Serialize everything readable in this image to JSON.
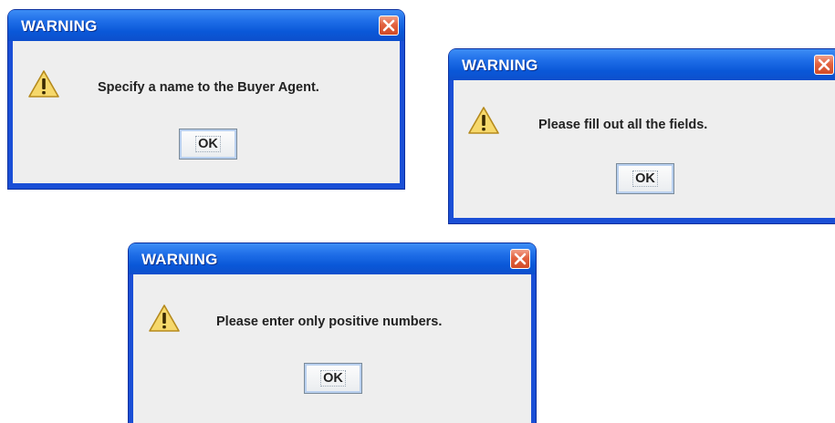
{
  "dialogs": [
    {
      "title": "WARNING",
      "message": "Specify a name to the Buyer Agent.",
      "ok_label": "OK",
      "icon": "warning-triangle-icon",
      "close_icon": "close-icon"
    },
    {
      "title": "WARNING",
      "message": "Please fill out all the fields.",
      "ok_label": "OK",
      "icon": "warning-triangle-icon",
      "close_icon": "close-icon"
    },
    {
      "title": "WARNING",
      "message": "Please enter only positive numbers.",
      "ok_label": "OK",
      "icon": "warning-triangle-icon",
      "close_icon": "close-icon"
    }
  ],
  "colors": {
    "titlebar": "#0a58d8",
    "close_button": "#d14a26",
    "dialog_body": "#eeeeee",
    "warning_icon_fill": "#f6d86b"
  }
}
